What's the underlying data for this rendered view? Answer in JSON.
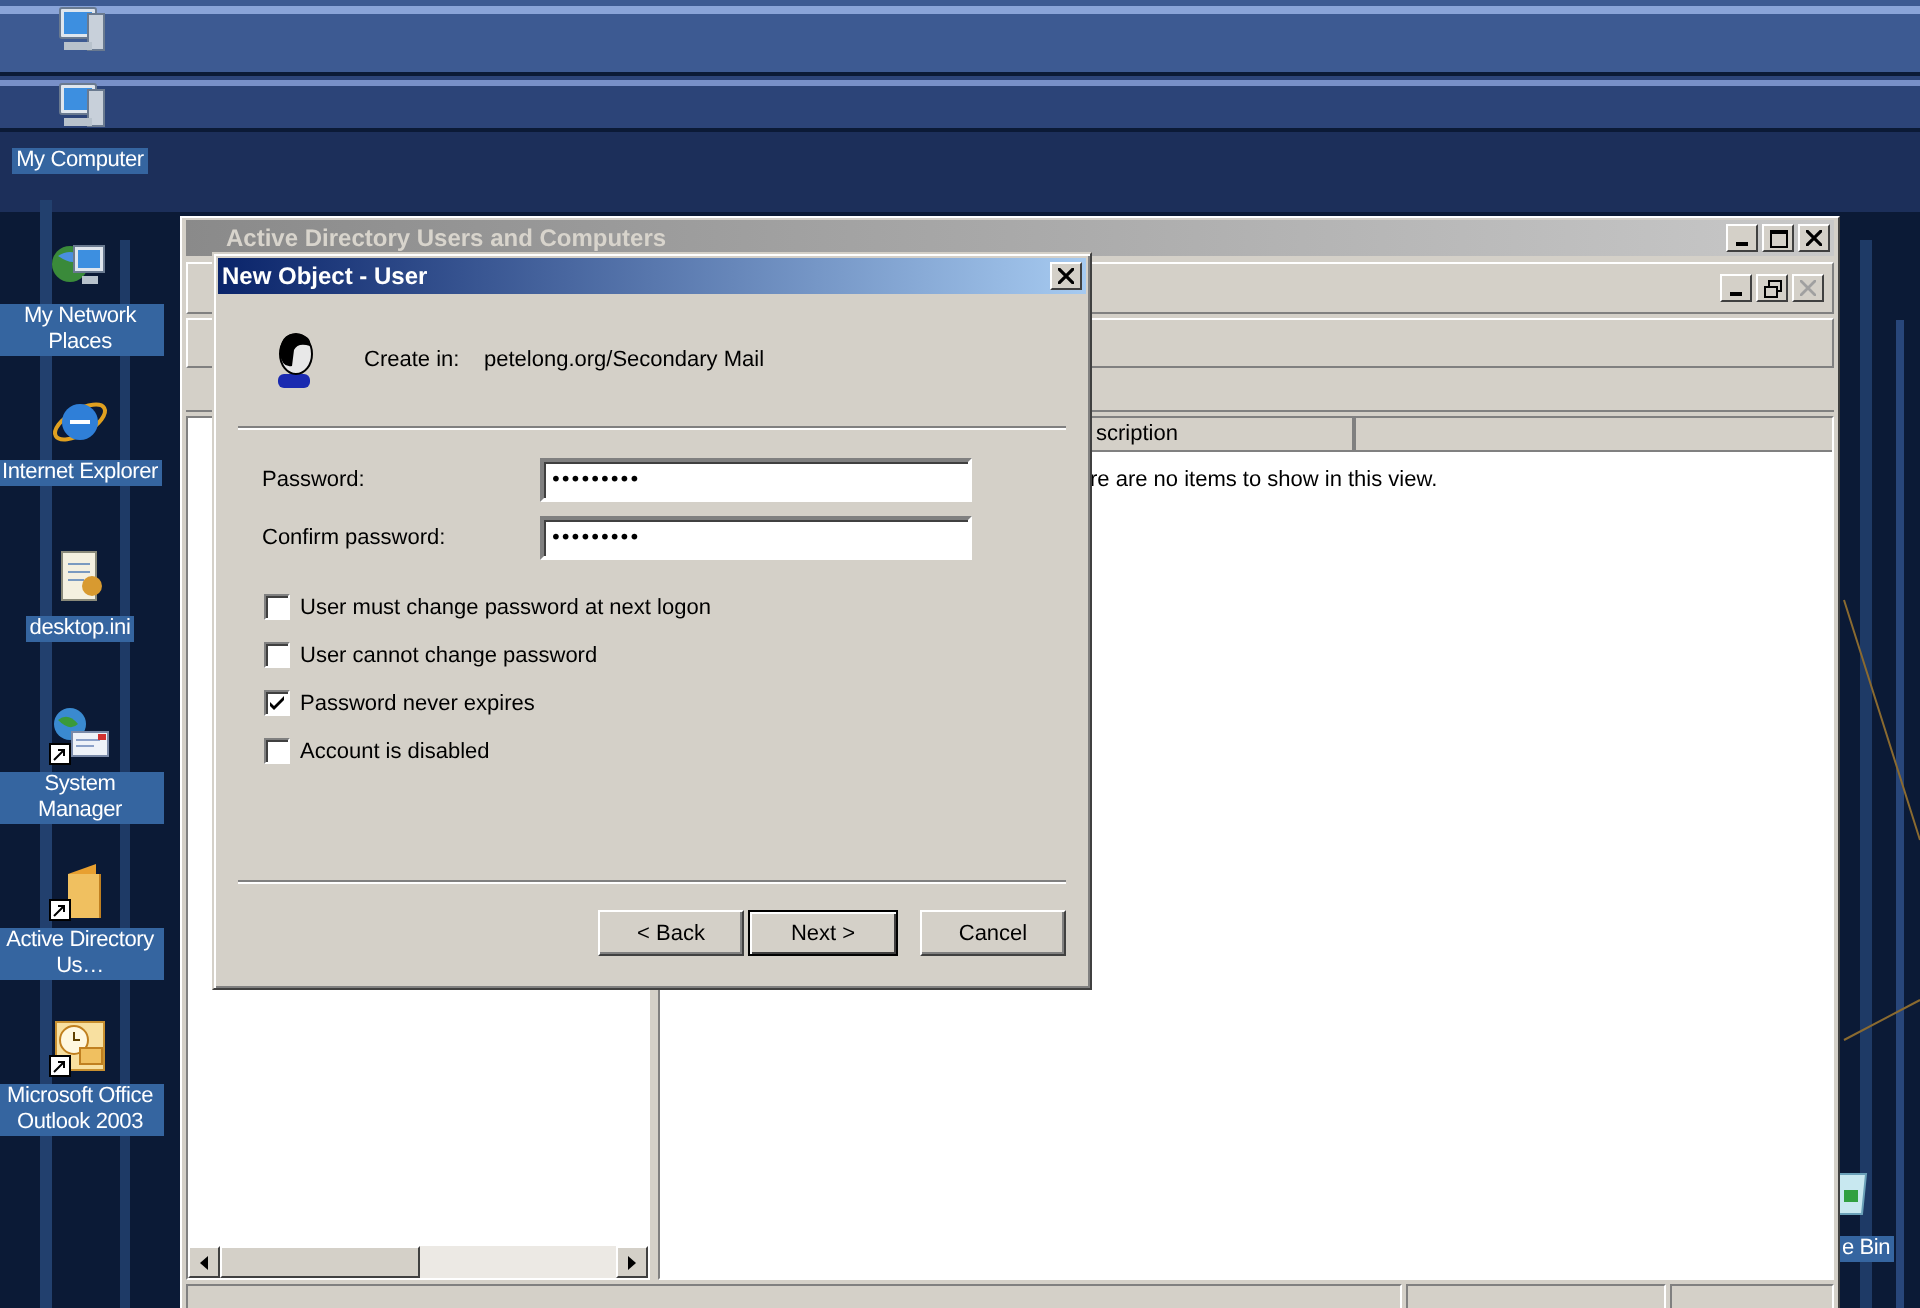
{
  "desktop_icons": [
    {
      "kind": "computer",
      "shortcut": false
    },
    {
      "kind": "computer",
      "label": "My Computer",
      "shortcut": false
    },
    {
      "kind": "network",
      "label": "My Network Places",
      "shortcut": false
    },
    {
      "kind": "browser",
      "label": "Internet Explorer",
      "shortcut": false
    },
    {
      "kind": "settings-file",
      "label": "desktop.ini",
      "shortcut": false
    },
    {
      "kind": "mail-globe",
      "label": "System Manager",
      "shortcut": true
    },
    {
      "kind": "folder",
      "label": "Active Directory Us…",
      "shortcut": true
    },
    {
      "kind": "calendar-mail",
      "label": "Microsoft Office Outlook 2003",
      "shortcut": true
    }
  ],
  "recycle_bin": {
    "label": "e Bin"
  },
  "main_window": {
    "title": "Active Directory Users and Computers",
    "list": {
      "column_header": "scription",
      "empty_message": "re are no items to show in this view."
    }
  },
  "dialog": {
    "title": "New Object - User",
    "create_in_label": "Create in:",
    "create_in_path": "petelong.org/Secondary Mail",
    "fields": [
      {
        "label": "Password:",
        "value": "•••••••••"
      },
      {
        "label": "Confirm password:",
        "value": "•••••••••"
      }
    ],
    "options": [
      {
        "label": "User must change password at next logon",
        "checked": false
      },
      {
        "label": "User cannot change password",
        "checked": false
      },
      {
        "label": "Password never expires",
        "checked": true
      },
      {
        "label": "Account is disabled",
        "checked": false
      }
    ],
    "buttons": [
      {
        "label": "< Back",
        "default": false
      },
      {
        "label": "Next >",
        "default": true
      },
      {
        "label": "Cancel",
        "default": false
      }
    ]
  }
}
